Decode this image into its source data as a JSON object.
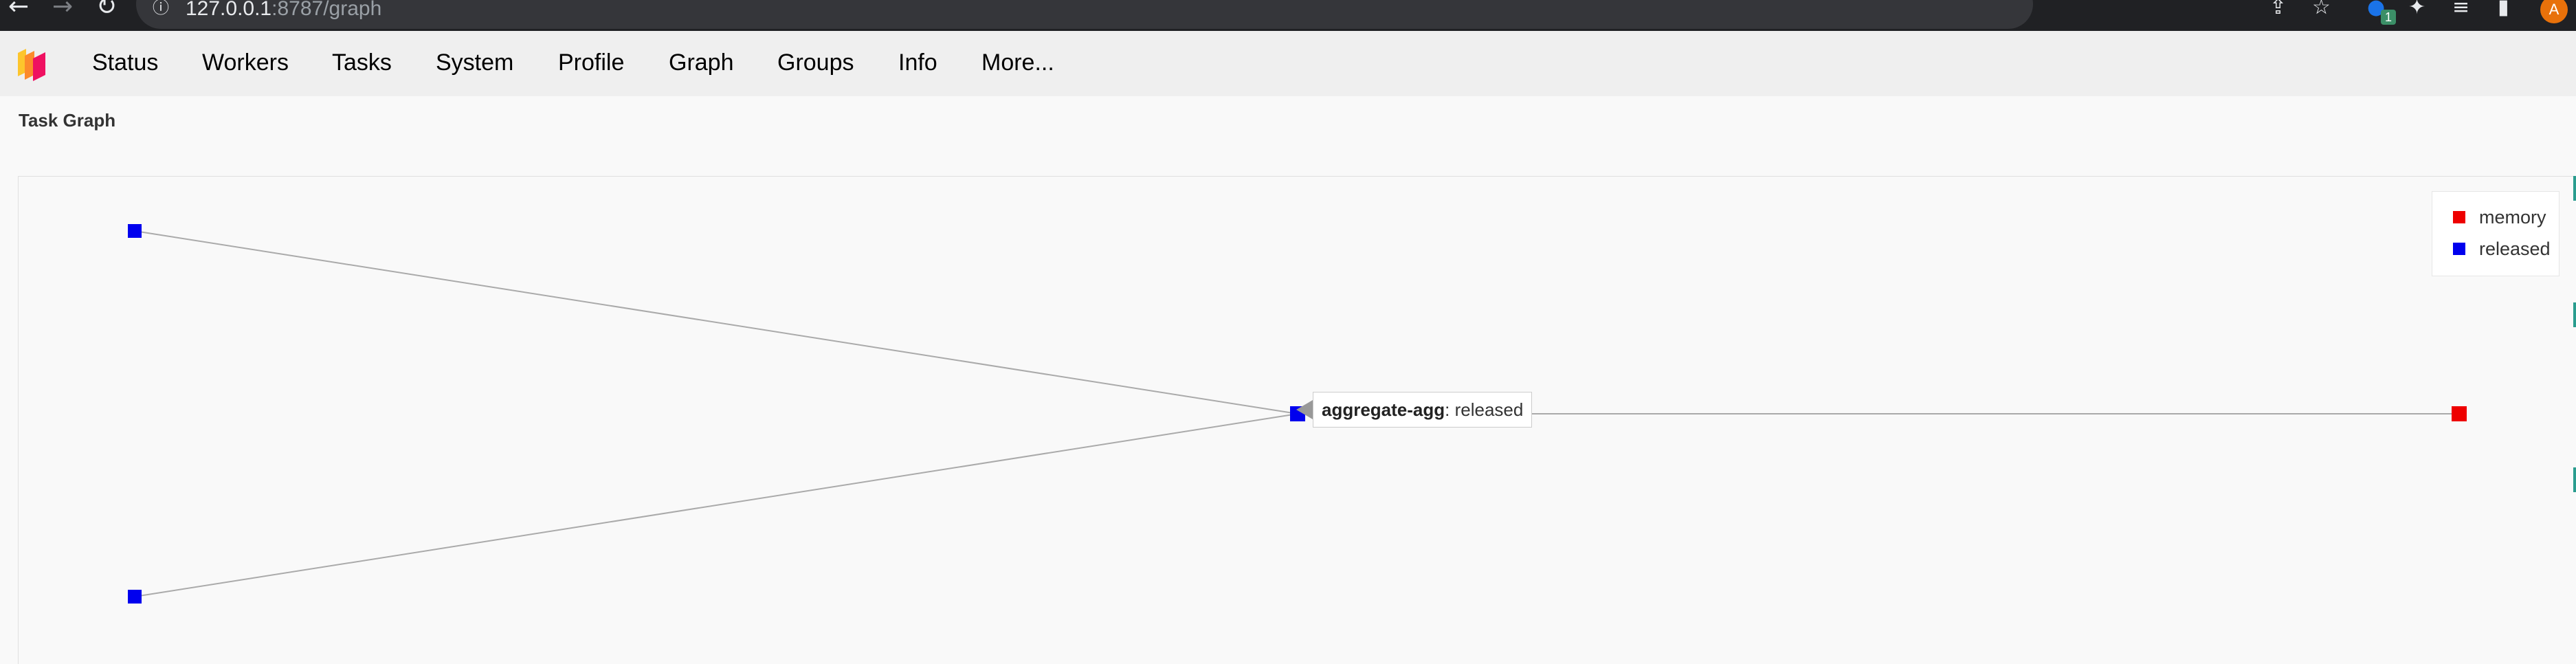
{
  "browser": {
    "url_host": "127.0.0.1",
    "url_rest": ":8787/graph",
    "ext_badge": "1",
    "avatar_letter": "A",
    "icons": [
      "back-icon",
      "forward-icon",
      "reload-icon",
      "info-icon",
      "share-icon",
      "star-icon",
      "extensions-icon",
      "reading-list-icon",
      "sidebar-icon"
    ]
  },
  "nav": {
    "items": [
      {
        "label": "Status"
      },
      {
        "label": "Workers"
      },
      {
        "label": "Tasks"
      },
      {
        "label": "System"
      },
      {
        "label": "Profile"
      },
      {
        "label": "Graph"
      },
      {
        "label": "Groups"
      },
      {
        "label": "Info"
      },
      {
        "label": "More..."
      }
    ]
  },
  "page": {
    "title": "Task Graph"
  },
  "legend": {
    "items": [
      {
        "label": "memory",
        "color": "#ee0000"
      },
      {
        "label": "released",
        "color": "#0000ee"
      }
    ]
  },
  "tooltip": {
    "name": "aggregate-agg",
    "state": ": released"
  },
  "graph": {
    "nodes": [
      {
        "id": "top-left",
        "state": "released"
      },
      {
        "id": "bottom-left",
        "state": "released"
      },
      {
        "id": "aggregate-agg",
        "state": "released"
      },
      {
        "id": "right",
        "state": "memory"
      }
    ],
    "edges": [
      {
        "from": "top-left",
        "to": "aggregate-agg"
      },
      {
        "from": "bottom-left",
        "to": "aggregate-agg"
      },
      {
        "from": "aggregate-agg",
        "to": "right"
      }
    ]
  },
  "colors": {
    "memory": "#ee0000",
    "released": "#0000ee",
    "edge": "#aaaaaa"
  }
}
